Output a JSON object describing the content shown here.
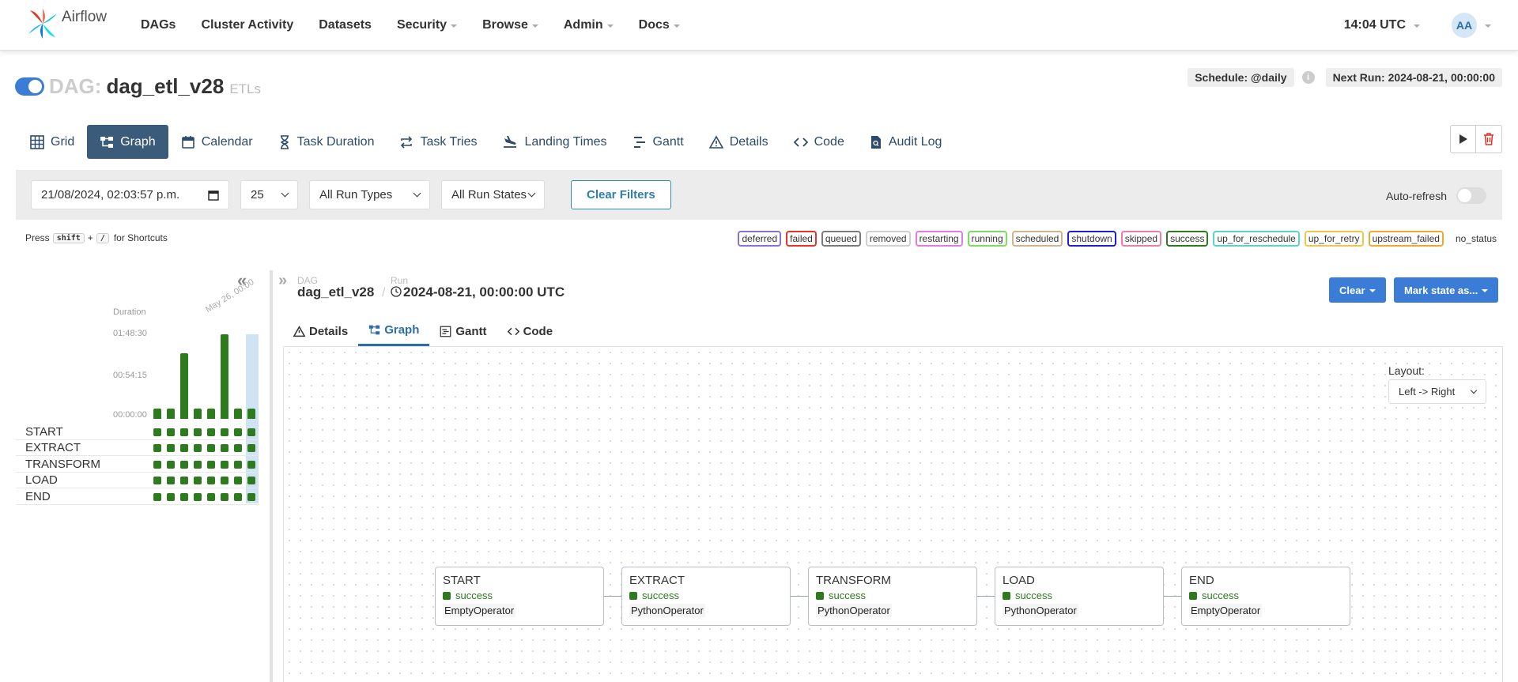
{
  "nav": {
    "brand": "Airflow",
    "items": [
      {
        "label": "DAGs",
        "dropdown": false
      },
      {
        "label": "Cluster Activity",
        "dropdown": false
      },
      {
        "label": "Datasets",
        "dropdown": false
      },
      {
        "label": "Security",
        "dropdown": true
      },
      {
        "label": "Browse",
        "dropdown": true
      },
      {
        "label": "Admin",
        "dropdown": true
      },
      {
        "label": "Docs",
        "dropdown": true
      }
    ],
    "time": "14:04 UTC",
    "avatar": "AA"
  },
  "dag": {
    "label": "DAG:",
    "name": "dag_etl_v28",
    "tag": "ETLs",
    "schedule": "Schedule: @daily",
    "next_run": "Next Run: 2024-08-21, 00:00:00"
  },
  "tabs": [
    {
      "label": "Grid",
      "icon": "grid-icon",
      "active": false
    },
    {
      "label": "Graph",
      "icon": "graph-icon",
      "active": true
    },
    {
      "label": "Calendar",
      "icon": "calendar-icon",
      "active": false
    },
    {
      "label": "Task Duration",
      "icon": "hourglass-icon",
      "active": false
    },
    {
      "label": "Task Tries",
      "icon": "retry-icon",
      "active": false
    },
    {
      "label": "Landing Times",
      "icon": "landing-icon",
      "active": false
    },
    {
      "label": "Gantt",
      "icon": "gantt-icon",
      "active": false
    },
    {
      "label": "Details",
      "icon": "warning-icon",
      "active": false
    },
    {
      "label": "Code",
      "icon": "code-icon",
      "active": false
    },
    {
      "label": "Audit Log",
      "icon": "document-icon",
      "active": false
    }
  ],
  "filters": {
    "datetime": "21/08/2024, 02:03:57 p.m.",
    "num_runs": "25",
    "run_types": "All Run Types",
    "run_states": "All Run States",
    "clear": "Clear Filters",
    "autorefresh": "Auto-refresh"
  },
  "shortcut": {
    "press": "Press",
    "key1": "shift",
    "plus": "+",
    "key2": "/",
    "suffix": "for Shortcuts"
  },
  "legend": [
    {
      "label": "deferred",
      "color": "#8a6fd6"
    },
    {
      "label": "failed",
      "color": "#e5342c"
    },
    {
      "label": "queued",
      "color": "#7a7a7a"
    },
    {
      "label": "removed",
      "color": "#cfcfcf"
    },
    {
      "label": "restarting",
      "color": "#e57ae5"
    },
    {
      "label": "running",
      "color": "#7ddc5f"
    },
    {
      "label": "scheduled",
      "color": "#d2b48c"
    },
    {
      "label": "shutdown",
      "color": "#1f1fcf"
    },
    {
      "label": "skipped",
      "color": "#f27aa6"
    },
    {
      "label": "success",
      "color": "#2e7a1e"
    },
    {
      "label": "up_for_reschedule",
      "color": "#56d6c8"
    },
    {
      "label": "up_for_retry",
      "color": "#f0c64a"
    },
    {
      "label": "upstream_failed",
      "color": "#f0a830"
    },
    {
      "label": "no_status",
      "color": ""
    }
  ],
  "grid": {
    "duration_label": "Duration",
    "ticks": [
      "01:48:30",
      "00:54:15",
      "00:00:00"
    ],
    "date_tick": "May 26, 00:00",
    "run_durations_fraction": [
      0.12,
      0.12,
      0.78,
      0.12,
      0.12,
      1.0,
      0.12,
      0.12
    ],
    "tasks": [
      "START",
      "EXTRACT",
      "TRANSFORM",
      "LOAD",
      "END"
    ]
  },
  "run": {
    "dag_small": "DAG",
    "dag_name": "dag_etl_v28",
    "run_small": "Run",
    "run_id": "2024-08-21, 00:00:00 UTC",
    "clear_btn": "Clear",
    "mark_btn": "Mark state as..."
  },
  "subtabs": [
    {
      "label": "Details",
      "icon": "warning-icon",
      "active": false
    },
    {
      "label": "Graph",
      "icon": "graph-icon",
      "active": true
    },
    {
      "label": "Gantt",
      "icon": "gantt-icon",
      "active": false
    },
    {
      "label": "Code",
      "icon": "code-icon",
      "active": false
    }
  ],
  "graph": {
    "layout_label": "Layout:",
    "layout_value": "Left -> Right",
    "nodes": [
      {
        "title": "START",
        "state": "success",
        "operator": "EmptyOperator"
      },
      {
        "title": "EXTRACT",
        "state": "success",
        "operator": "PythonOperator"
      },
      {
        "title": "TRANSFORM",
        "state": "success",
        "operator": "PythonOperator"
      },
      {
        "title": "LOAD",
        "state": "success",
        "operator": "PythonOperator"
      },
      {
        "title": "END",
        "state": "success",
        "operator": "EmptyOperator"
      }
    ]
  },
  "colors": {
    "success": "#2e7a1e",
    "primary": "#3a7cd6",
    "active_tab": "#3b5b7a"
  }
}
